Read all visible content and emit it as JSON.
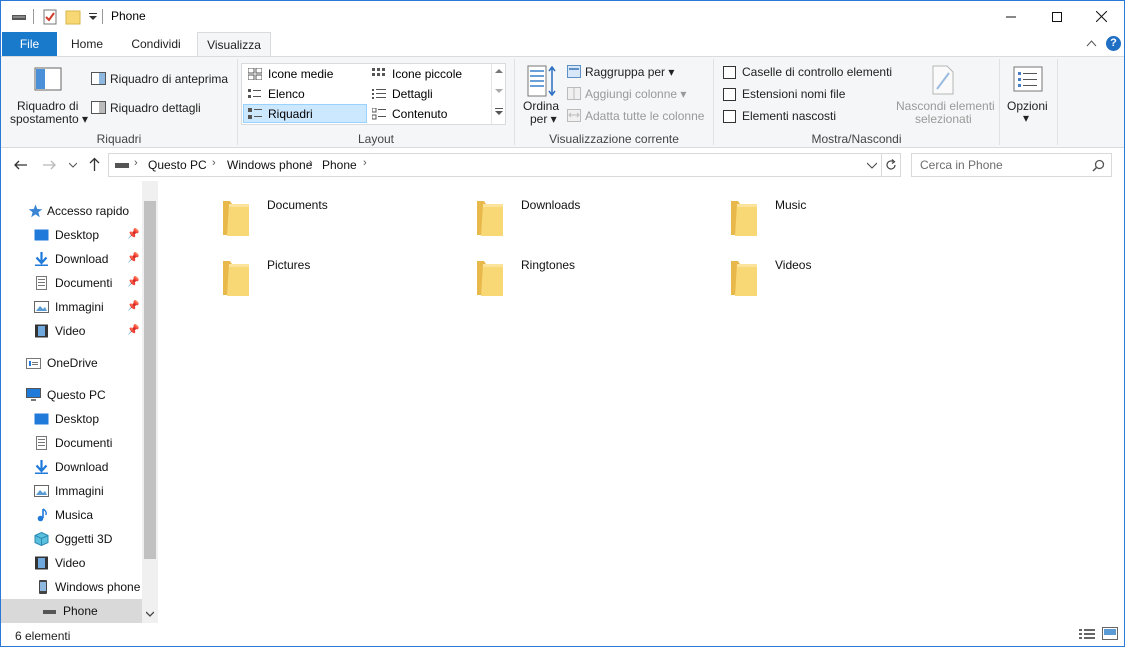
{
  "window": {
    "title": "Phone"
  },
  "tabs": {
    "file": "File",
    "home": "Home",
    "share": "Condividi",
    "view": "Visualizza"
  },
  "ribbon": {
    "panes": {
      "nav_pane_line1": "Riquadro di",
      "nav_pane_line2": "spostamento",
      "preview": "Riquadro di anteprima",
      "details": "Riquadro dettagli",
      "group": "Riquadri"
    },
    "layout": {
      "items": [
        "Icone medie",
        "Icone piccole",
        "Elenco",
        "Dettagli",
        "Riquadri",
        "Contenuto"
      ],
      "selected": "Riquadri",
      "group": "Layout"
    },
    "current_view": {
      "sort_line1": "Ordina",
      "sort_line2": "per",
      "group_by": "Raggruppa per",
      "add_columns": "Aggiungi colonne",
      "fit_columns": "Adatta tutte le colonne",
      "group": "Visualizzazione corrente"
    },
    "show_hide": {
      "item_checkboxes": "Caselle di controllo elementi",
      "file_extensions": "Estensioni nomi file",
      "hidden_items": "Elementi nascosti",
      "hide_selected_line1": "Nascondi elementi",
      "hide_selected_line2": "selezionati",
      "group": "Mostra/Nascondi"
    },
    "options": "Opzioni"
  },
  "address": {
    "breadcrumbs": [
      "Questo PC",
      "Windows phone",
      "Phone"
    ],
    "search_placeholder": "Cerca in Phone"
  },
  "nav": {
    "quick_access": "Accesso rapido",
    "quick_items": [
      "Desktop",
      "Download",
      "Documenti",
      "Immagini",
      "Video"
    ],
    "onedrive": "OneDrive",
    "this_pc": "Questo PC",
    "pc_items": [
      "Desktop",
      "Documenti",
      "Download",
      "Immagini",
      "Musica",
      "Oggetti 3D",
      "Video",
      "Windows phone"
    ],
    "phone": "Phone"
  },
  "folders": [
    "Documents",
    "Downloads",
    "Music",
    "Pictures",
    "Ringtones",
    "Videos"
  ],
  "status": {
    "count": "6 elementi"
  },
  "colors": {
    "accent": "#1979ca",
    "folder": "#f8d775",
    "selection": "#cce8ff"
  }
}
